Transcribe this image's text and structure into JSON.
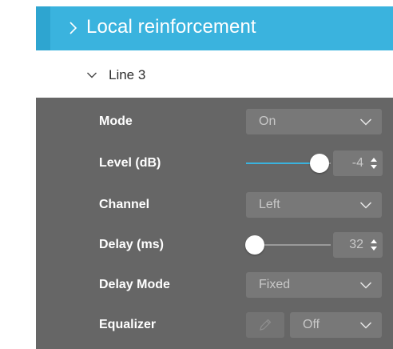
{
  "header": {
    "title": "Local reinforcement",
    "icon": "chevron-right-icon",
    "accent": "#3ab3de"
  },
  "subsection": {
    "title": "Line 3",
    "icon": "chevron-down-icon"
  },
  "settings": {
    "mode": {
      "label": "Mode",
      "value": "On"
    },
    "level": {
      "label": "Level (dB)",
      "value": "-4",
      "slider_fraction": 0.87
    },
    "channel": {
      "label": "Channel",
      "value": "Left"
    },
    "delay": {
      "label": "Delay (ms)",
      "value": "32",
      "slider_fraction": 0.1
    },
    "delay_mode": {
      "label": "Delay Mode",
      "value": "Fixed"
    },
    "equalizer": {
      "label": "Equalizer",
      "value": "Off",
      "edit_icon": "pencil-icon"
    }
  }
}
